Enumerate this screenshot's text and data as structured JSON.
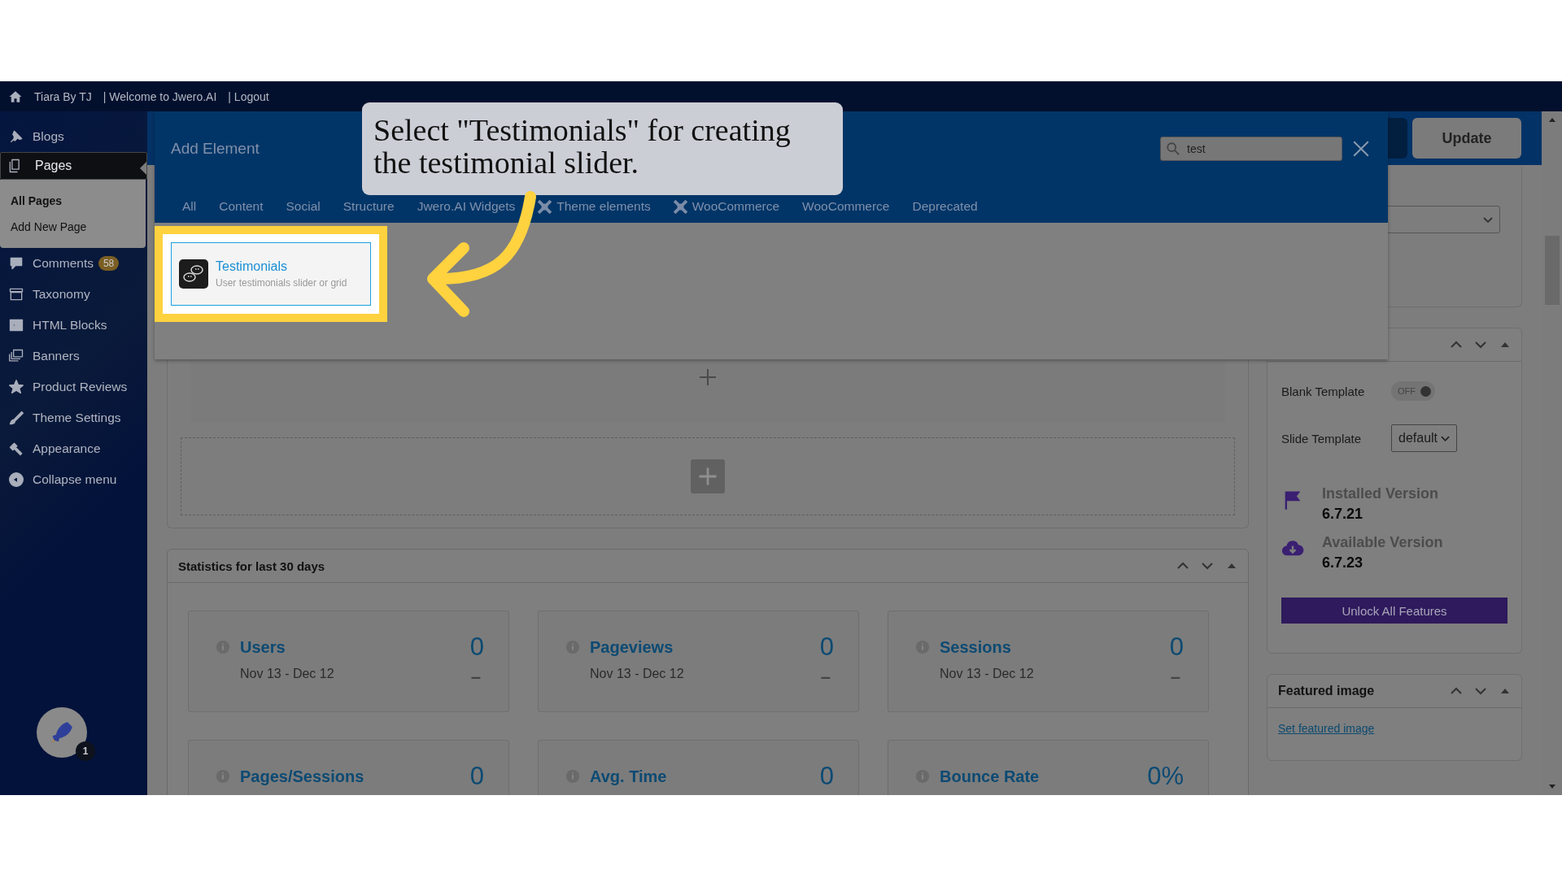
{
  "top_bar": {
    "items": [
      "Tiara By TJ",
      "| Welcome to Jwero.AI",
      "| Logout"
    ]
  },
  "sidebar": {
    "items": [
      {
        "label": "Blogs",
        "selected": false
      },
      {
        "label": "Pages",
        "selected": true,
        "children": [
          {
            "label": "All Pages",
            "selected": true
          },
          {
            "label": "Add New Page",
            "selected": false
          }
        ]
      },
      {
        "label": "Comments",
        "selected": false,
        "badge": "58"
      },
      {
        "label": "Taxonomy",
        "selected": false
      },
      {
        "label": "HTML Blocks",
        "selected": false
      },
      {
        "label": "Banners",
        "selected": false
      },
      {
        "label": "Product Reviews",
        "selected": false
      },
      {
        "label": "Theme Settings",
        "selected": false
      },
      {
        "label": "Appearance",
        "selected": false
      },
      {
        "label": "Collapse menu",
        "selected": false
      }
    ],
    "launcher_badge": "1"
  },
  "header": {
    "update_button": "Update"
  },
  "modal": {
    "title": "Add Element",
    "search": {
      "value": "test"
    },
    "tabs": [
      {
        "label": "All",
        "kind": "plain",
        "selected": false
      },
      {
        "label": "Content",
        "kind": "plain",
        "selected": false
      },
      {
        "label": "Social",
        "kind": "plain",
        "selected": false
      },
      {
        "label": "Structure",
        "kind": "plain",
        "selected": false
      },
      {
        "label": "Jwero.AI Widgets",
        "kind": "plain",
        "selected": false
      },
      {
        "label": "Theme elements",
        "kind": "plugin",
        "selected": false
      },
      {
        "label": "WooCommerce",
        "kind": "plugin",
        "selected": false
      },
      {
        "label": "WooCommerce",
        "kind": "plain",
        "selected": false
      },
      {
        "label": "Deprecated",
        "kind": "plain",
        "selected": false
      }
    ],
    "results": [
      {
        "title": "Testimonials",
        "description": "User testimonials slider or grid",
        "highlighted": true
      }
    ]
  },
  "callout": {
    "text": "Select \"Testimonials\" for creating the testimonial slider."
  },
  "stats": {
    "title": "Statistics for last 30 days",
    "cards": [
      {
        "label": "Users",
        "value": "0",
        "range": "Nov 13 - Dec 12",
        "change": "–"
      },
      {
        "label": "Pageviews",
        "value": "0",
        "range": "Nov 13 - Dec 12",
        "change": "–"
      },
      {
        "label": "Sessions",
        "value": "0",
        "range": "Nov 13 - Dec 12",
        "change": "–"
      },
      {
        "label": "Pages/Sessions",
        "value": "0"
      },
      {
        "label": "Avg. Time",
        "value": "0"
      },
      {
        "label": "Bounce Rate",
        "value": "0%"
      }
    ]
  },
  "slider_settings": {
    "rows": [
      {
        "kind": "toggle",
        "label": "Blank Template",
        "on": false,
        "text": "OFF"
      },
      {
        "kind": "select",
        "label": "Slide Template",
        "value": "default"
      }
    ],
    "versions": [
      {
        "kind": "flag",
        "label": "Installed Version",
        "value": "6.7.21"
      },
      {
        "kind": "download",
        "label": "Available Version",
        "value": "6.7.23"
      }
    ],
    "button": "Unlock All Features"
  },
  "featured_image": {
    "title": "Featured image",
    "link": "Set featured image"
  }
}
